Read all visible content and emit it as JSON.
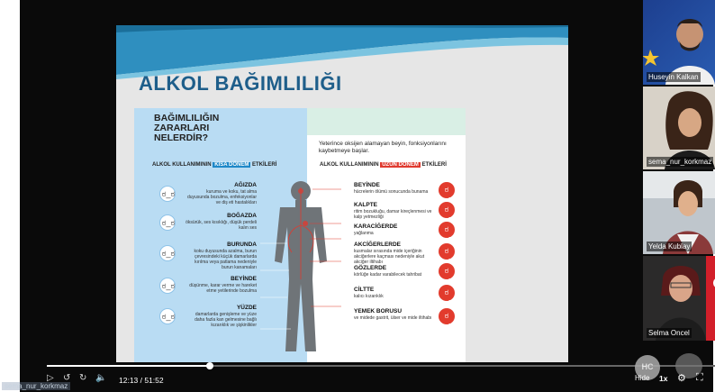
{
  "slide": {
    "title": "ALKOL BAĞIMLILIĞI",
    "info_title": [
      "BAĞIMLILIĞIN",
      "ZARARLARI",
      "NELERDİR?"
    ],
    "oxygen_note": "Yeterince oksijen alamayan beyin, fonksiyonlarını kaybetmeye başlar.",
    "short_term_head": {
      "pre": "ALKOL KULLANIMININ ",
      "hl": "KISA DÖNEM",
      "post": " ETKİLERİ"
    },
    "long_term_head": {
      "pre": "ALKOL KULLANIMININ ",
      "hl": "UZUN DÖNEM",
      "post": " ETKİLERİ"
    },
    "short_term": [
      {
        "title": "AĞIZDA",
        "desc": "kuruma ve koku, tat alma duyusunda bozulma, enfeksiyonlar ve diş eti hastalıkları"
      },
      {
        "title": "BOĞAZDA",
        "desc": "öksürük, ses kısıklığı, düşük perdeli kalın ses"
      },
      {
        "title": "BURUNDA",
        "desc": "koku duyusunda azalma, burun çevresindeki küçük damarlarda kırılma veya patlama nedeniyle burun kanamaları"
      },
      {
        "title": "BEYİNDE",
        "desc": "düşünme, karar verme ve hareket etme yetilerinde bozulma"
      },
      {
        "title": "YÜZDE",
        "desc": "damarlarda genişleme ve yüze daha fazla kan gelmesine bağlı kızarıklık ve şişkinlikler"
      }
    ],
    "long_term": [
      {
        "title": "BEYİNDE",
        "desc": "hücrelerin ölümü sonucunda bunama"
      },
      {
        "title": "KALPTE",
        "desc": "ritim bozukluğu, damar kireçlenmesi ve kalp yetmezliği"
      },
      {
        "title": "KARACİĞERDE",
        "desc": "yağlanma"
      },
      {
        "title": "AKCİĞERLERDE",
        "desc": "kusmalar sırasında mide içeriğinin akciğerlere kaçması nedeniyle akut akciğer iltihabı"
      },
      {
        "title": "GÖZLERDE",
        "desc": "körlüğe kadar varabilecek tahribat"
      },
      {
        "title": "CİLTTE",
        "desc": "kalıcı kızarıklık"
      },
      {
        "title": "YEMEK BORUSU",
        "desc": "ve midede gastrit, ülser ve mide iltihabı"
      }
    ]
  },
  "participants": [
    {
      "name": "Huseyin Kalkan"
    },
    {
      "name": "sema_nur_korkmaz"
    },
    {
      "name": "Yelda Kublay"
    },
    {
      "name": "Selma Oncel"
    }
  ],
  "player": {
    "time": "12:13 / 51:52",
    "progress": 0.24,
    "speed": "1x",
    "hide_label": "Hide",
    "watermark": "sema_nur_korkmaz",
    "circle_label": "HC"
  },
  "colors": {
    "title": "#1e5e8a",
    "short_term": "#1e88c8",
    "long_term": "#e03a2f"
  },
  "icons": [
    "play-icon",
    "rewind-icon",
    "forward-icon",
    "volume-icon",
    "settings-icon",
    "fullscreen-icon"
  ]
}
